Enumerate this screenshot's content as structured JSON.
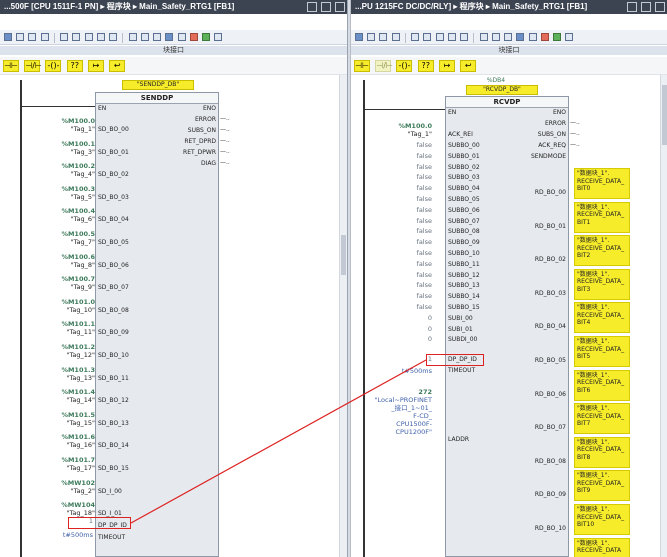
{
  "left": {
    "title": "...500F [CPU 1511F-1 PN] ▸ 程序块 ▸ Main_Safety_RTG1 [FB1]",
    "interface_label": "块接口",
    "instance_db": "\"SENDDP_DB\"",
    "block_name": "SENDDP",
    "outputs": [
      "ENO",
      "ERROR",
      "SUBS_ON",
      "RET_DPRD",
      "RET_DPWR",
      "DIAG"
    ],
    "inputs": [
      {
        "addr": "%M100.0",
        "tag": "\"Tag_1\"",
        "pin": "SD_BO_00"
      },
      {
        "addr": "%M100.1",
        "tag": "\"Tag_3\"",
        "pin": "SD_BO_01"
      },
      {
        "addr": "%M100.2",
        "tag": "\"Tag_4\"",
        "pin": "SD_BO_02"
      },
      {
        "addr": "%M100.3",
        "tag": "\"Tag_5\"",
        "pin": "SD_BO_03"
      },
      {
        "addr": "%M100.4",
        "tag": "\"Tag_6\"",
        "pin": "SD_BO_04"
      },
      {
        "addr": "%M100.5",
        "tag": "\"Tag_7\"",
        "pin": "SD_BO_05"
      },
      {
        "addr": "%M100.6",
        "tag": "\"Tag_8\"",
        "pin": "SD_BO_06"
      },
      {
        "addr": "%M100.7",
        "tag": "\"Tag_9\"",
        "pin": "SD_BO_07"
      },
      {
        "addr": "%M101.0",
        "tag": "\"Tag_10\"",
        "pin": "SD_BO_08"
      },
      {
        "addr": "%M101.1",
        "tag": "\"Tag_11\"",
        "pin": "SD_BO_09"
      },
      {
        "addr": "%M101.2",
        "tag": "\"Tag_12\"",
        "pin": "SD_BO_10"
      },
      {
        "addr": "%M101.3",
        "tag": "\"Tag_13\"",
        "pin": "SD_BO_11"
      },
      {
        "addr": "%M101.4",
        "tag": "\"Tag_14\"",
        "pin": "SD_BO_12"
      },
      {
        "addr": "%M101.5",
        "tag": "\"Tag_15\"",
        "pin": "SD_BO_13"
      },
      {
        "addr": "%M101.6",
        "tag": "\"Tag_16\"",
        "pin": "SD_BO_14"
      },
      {
        "addr": "%M101.7",
        "tag": "\"Tag_17\"",
        "pin": "SD_BO_15"
      },
      {
        "addr": "%MW102",
        "tag": "\"Tag_2\"",
        "pin": "SD_I_00"
      },
      {
        "addr": "%MW104",
        "tag": "\"Tag_18\"",
        "pin": "SD_I_01"
      }
    ],
    "dp_id_value": "1",
    "dp_id_pin": "DP_DP_ID",
    "timeout_value": "t#500ms",
    "timeout_pin": "TIMEOUT"
  },
  "right": {
    "title": "...PU 1215FC DC/DC/RLY] ▸ 程序块 ▸ Main_Safety_RTG1 [FB1]",
    "interface_label": "块接口",
    "instance_addr": "%DB4",
    "instance_db": "\"RCVDP_DB\"",
    "block_name": "RCVDP",
    "outputs_top": [
      "ENO",
      "ERROR",
      "SUBS_ON",
      "ACK_REQ",
      "SENDMODE"
    ],
    "en_pin": "EN",
    "ack_rei": {
      "addr": "%M100.0",
      "tag": "\"Tag_1\"",
      "pin": "ACK_REI"
    },
    "subbo_inputs": [
      {
        "value": "false",
        "pin": "SUBBO_00"
      },
      {
        "value": "false",
        "pin": "SUBBO_01"
      },
      {
        "value": "false",
        "pin": "SUBBO_02"
      },
      {
        "value": "false",
        "pin": "SUBBO_03"
      },
      {
        "value": "false",
        "pin": "SUBBO_04"
      },
      {
        "value": "false",
        "pin": "SUBBO_05"
      },
      {
        "value": "false",
        "pin": "SUBBO_06"
      },
      {
        "value": "false",
        "pin": "SUBBO_07"
      },
      {
        "value": "false",
        "pin": "SUBBO_08"
      },
      {
        "value": "false",
        "pin": "SUBBO_09"
      },
      {
        "value": "false",
        "pin": "SUBBO_10"
      },
      {
        "value": "false",
        "pin": "SUBBO_11"
      },
      {
        "value": "false",
        "pin": "SUBBO_12"
      },
      {
        "value": "false",
        "pin": "SUBBO_13"
      },
      {
        "value": "false",
        "pin": "SUBBO_14"
      },
      {
        "value": "false",
        "pin": "SUBBO_15"
      }
    ],
    "subi_inputs": [
      {
        "value": "0",
        "pin": "SUBI_00"
      },
      {
        "value": "0",
        "pin": "SUBI_01"
      },
      {
        "value": "0",
        "pin": "SUBDI_00"
      }
    ],
    "dp_id_value": "1",
    "dp_id_pin": "DP_DP_ID",
    "timeout_value": "t#500ms",
    "timeout_pin": "TIMEOUT",
    "laddr_num": "272",
    "laddr_lines": [
      "\"Local~PROFINET",
      "_接口_1~01_",
      "F-CD_",
      "CPU1500F-",
      "CPU1200F\""
    ],
    "laddr_pin": "LADDR",
    "rd_outputs": [
      {
        "pin": "RD_BO_00",
        "tag": [
          "\"数据块_1\".",
          "RECEIVE_DATA_",
          "BIT0"
        ]
      },
      {
        "pin": "RD_BO_01",
        "tag": [
          "\"数据块_1\".",
          "RECEIVE_DATA_",
          "BIT1"
        ]
      },
      {
        "pin": "RD_BO_02",
        "tag": [
          "\"数据块_1\".",
          "RECEIVE_DATA_",
          "BIT2"
        ]
      },
      {
        "pin": "RD_BO_03",
        "tag": [
          "\"数据块_1\".",
          "RECEIVE_DATA_",
          "BIT3"
        ]
      },
      {
        "pin": "RD_BO_04",
        "tag": [
          "\"数据块_1\".",
          "RECEIVE_DATA_",
          "BIT4"
        ]
      },
      {
        "pin": "RD_BO_05",
        "tag": [
          "\"数据块_1\".",
          "RECEIVE_DATA_",
          "BIT5"
        ]
      },
      {
        "pin": "RD_BO_06",
        "tag": [
          "\"数据块_1\".",
          "RECEIVE_DATA_",
          "BIT6"
        ]
      },
      {
        "pin": "RD_BO_07",
        "tag": [
          "\"数据块_1\".",
          "RECEIVE_DATA_",
          "BIT7"
        ]
      },
      {
        "pin": "RD_BO_08",
        "tag": [
          "\"数据块_1\".",
          "RECEIVE_DATA_",
          "BIT8"
        ]
      },
      {
        "pin": "RD_BO_09",
        "tag": [
          "\"数据块_1\".",
          "RECEIVE_DATA_",
          "BIT9"
        ]
      },
      {
        "pin": "RD_BO_10",
        "tag": [
          "\"数据块_1\".",
          "RECEIVE_DATA_",
          "BIT10"
        ]
      },
      {
        "pin": "",
        "tag": [
          "\"数据块_1\".",
          "RECEIVE_DATA",
          ""
        ]
      }
    ]
  },
  "colors": {
    "titlebar": "#3c4452",
    "highlight": "#dd2222",
    "yellow": "#f7ec2a",
    "operand_green": "#3c7a5a",
    "operand_blue": "#3d5fa8"
  }
}
